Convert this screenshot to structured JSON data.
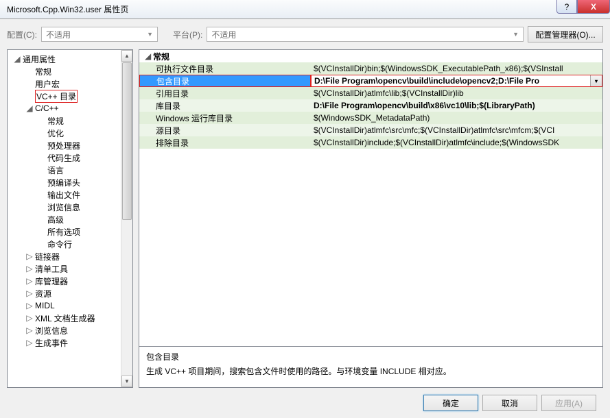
{
  "window": {
    "title": "Microsoft.Cpp.Win32.user 属性页",
    "help": "?",
    "close": "X"
  },
  "top": {
    "config_label": "配置(C):",
    "config_value": "不适用",
    "platform_label": "平台(P):",
    "platform_value": "不适用",
    "cfgmgr": "配置管理器(O)..."
  },
  "tree": [
    {
      "lvl": 0,
      "tw": "◢",
      "label": "通用属性"
    },
    {
      "lvl": 1,
      "tw": "",
      "label": "常规"
    },
    {
      "lvl": 1,
      "tw": "",
      "label": "用户宏"
    },
    {
      "lvl": 1,
      "tw": "",
      "label": "VC++ 目录",
      "hi": true
    },
    {
      "lvl": 1,
      "tw": "◢",
      "label": "C/C++"
    },
    {
      "lvl": 2,
      "tw": "",
      "label": "常规"
    },
    {
      "lvl": 2,
      "tw": "",
      "label": "优化"
    },
    {
      "lvl": 2,
      "tw": "",
      "label": "预处理器"
    },
    {
      "lvl": 2,
      "tw": "",
      "label": "代码生成"
    },
    {
      "lvl": 2,
      "tw": "",
      "label": "语言"
    },
    {
      "lvl": 2,
      "tw": "",
      "label": "预编译头"
    },
    {
      "lvl": 2,
      "tw": "",
      "label": "输出文件"
    },
    {
      "lvl": 2,
      "tw": "",
      "label": "浏览信息"
    },
    {
      "lvl": 2,
      "tw": "",
      "label": "高级"
    },
    {
      "lvl": 2,
      "tw": "",
      "label": "所有选项"
    },
    {
      "lvl": 2,
      "tw": "",
      "label": "命令行"
    },
    {
      "lvl": 1,
      "tw": "▷",
      "label": "链接器"
    },
    {
      "lvl": 1,
      "tw": "▷",
      "label": "清单工具"
    },
    {
      "lvl": 1,
      "tw": "▷",
      "label": "库管理器"
    },
    {
      "lvl": 1,
      "tw": "▷",
      "label": "资源"
    },
    {
      "lvl": 1,
      "tw": "▷",
      "label": "MIDL"
    },
    {
      "lvl": 1,
      "tw": "▷",
      "label": "XML 文档生成器"
    },
    {
      "lvl": 1,
      "tw": "▷",
      "label": "浏览信息"
    },
    {
      "lvl": 1,
      "tw": "▷",
      "label": "生成事件"
    }
  ],
  "grid": {
    "section": "常规",
    "rows": [
      {
        "name": "可执行文件目录",
        "value": "$(VCInstallDir)bin;$(WindowsSDK_ExecutablePath_x86);$(VSInstall",
        "selected": false
      },
      {
        "name": "包含目录",
        "value": "D:\\File Program\\opencv\\build\\include\\opencv2;D:\\File Pro",
        "selected": true
      },
      {
        "name": "引用目录",
        "value": "$(VCInstallDir)atlmfc\\lib;$(VCInstallDir)lib",
        "selected": false
      },
      {
        "name": "库目录",
        "value": "D:\\File Program\\opencv\\build\\x86\\vc10\\lib;$(LibraryPath)",
        "selected": false,
        "bold": true
      },
      {
        "name": "Windows 运行库目录",
        "value": "$(WindowsSDK_MetadataPath)",
        "selected": false
      },
      {
        "name": "源目录",
        "value": "$(VCInstallDir)atlmfc\\src\\mfc;$(VCInstallDir)atlmfc\\src\\mfcm;$(VCI",
        "selected": false
      },
      {
        "name": "排除目录",
        "value": "$(VCInstallDir)include;$(VCInstallDir)atlmfc\\include;$(WindowsSDK",
        "selected": false
      }
    ]
  },
  "desc": {
    "title": "包含目录",
    "text": "生成 VC++ 项目期间，搜索包含文件时使用的路径。与环境变量 INCLUDE 相对应。"
  },
  "footer": {
    "ok": "确定",
    "cancel": "取消",
    "apply": "应用(A)"
  }
}
